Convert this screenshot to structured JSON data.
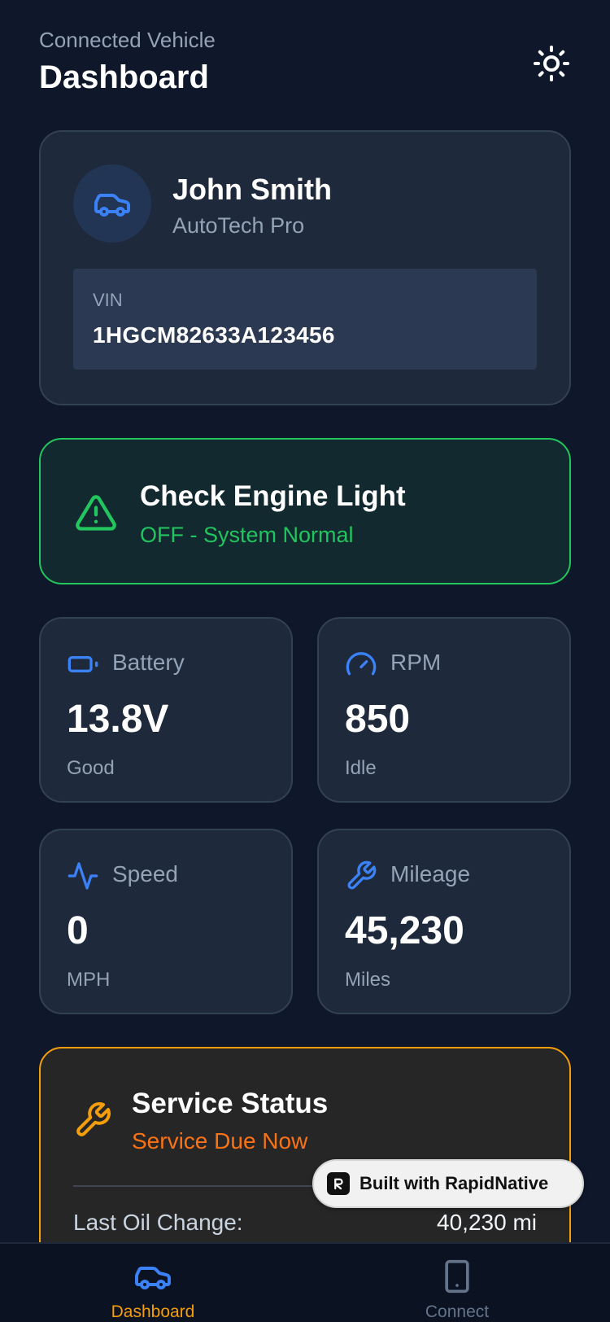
{
  "header": {
    "subtitle": "Connected Vehicle",
    "title": "Dashboard",
    "theme_icon": "sun-icon"
  },
  "profile": {
    "name": "John Smith",
    "company": "AutoTech Pro",
    "avatar_icon": "car-icon",
    "vin_label": "VIN",
    "vin_value": "1HGCM82633A123456"
  },
  "alert": {
    "icon": "warning-triangle-icon",
    "title": "Check Engine Light",
    "status": "OFF - System Normal",
    "color": "#22c55e"
  },
  "metrics": [
    {
      "icon": "battery-icon",
      "label": "Battery",
      "value": "13.8V",
      "sub": "Good"
    },
    {
      "icon": "gauge-icon",
      "label": "RPM",
      "value": "850",
      "sub": "Idle"
    },
    {
      "icon": "activity-icon",
      "label": "Speed",
      "value": "0",
      "sub": "MPH"
    },
    {
      "icon": "wrench-icon",
      "label": "Mileage",
      "value": "45,230",
      "sub": "Miles"
    }
  ],
  "service": {
    "icon": "wrench-icon",
    "title": "Service Status",
    "status": "Service Due Now",
    "row_label": "Last Oil Change:",
    "row_value": "40,230 mi",
    "accent": "#f59e0b"
  },
  "badge": {
    "label": "Built with RapidNative"
  },
  "nav": {
    "dashboard_label": "Dashboard",
    "connect_label": "Connect",
    "active_color": "#f59e0b"
  }
}
